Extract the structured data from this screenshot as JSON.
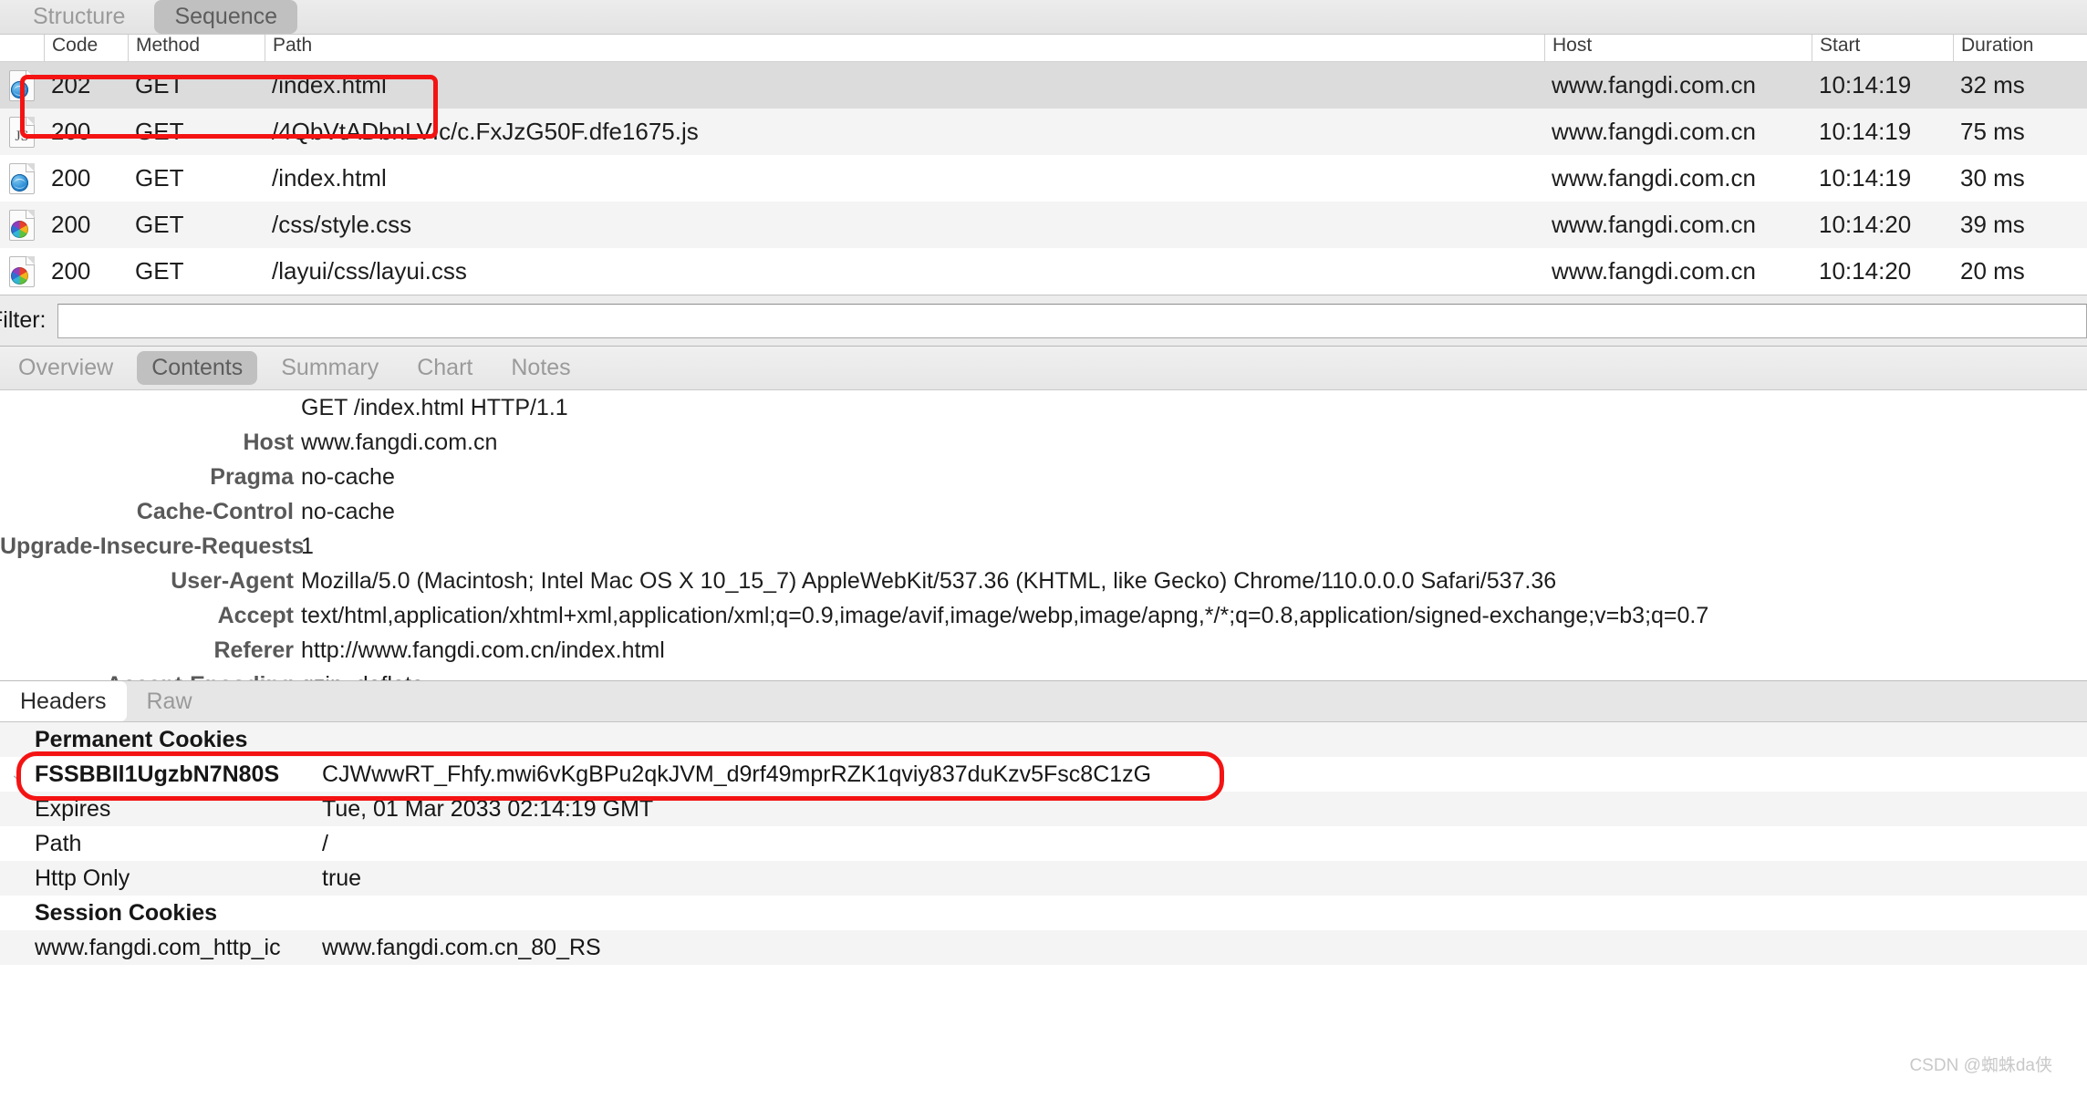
{
  "top_tabs": [
    {
      "label": "Structure",
      "active": false
    },
    {
      "label": "Sequence",
      "active": true
    }
  ],
  "request_table": {
    "columns": [
      "",
      "Code",
      "Method",
      "Path",
      "Host",
      "Start",
      "Duration"
    ],
    "rows": [
      {
        "icon": "html-document-icon",
        "code": "202",
        "method": "GET",
        "path": "/index.html",
        "host": "www.fangdi.com.cn",
        "start": "10:14:19",
        "duration": "32 ms",
        "selected": true
      },
      {
        "icon": "js-document-icon",
        "code": "200",
        "method": "GET",
        "path": "/4QbVtADbnLVIc/c.FxJzG50F.dfe1675.js",
        "host": "www.fangdi.com.cn",
        "start": "10:14:19",
        "duration": "75 ms",
        "selected": false
      },
      {
        "icon": "html-document-icon",
        "code": "200",
        "method": "GET",
        "path": "/index.html",
        "host": "www.fangdi.com.cn",
        "start": "10:14:19",
        "duration": "30 ms",
        "selected": false
      },
      {
        "icon": "css-document-icon",
        "code": "200",
        "method": "GET",
        "path": "/css/style.css",
        "host": "www.fangdi.com.cn",
        "start": "10:14:20",
        "duration": "39 ms",
        "selected": false
      },
      {
        "icon": "css-document-icon",
        "code": "200",
        "method": "GET",
        "path": "/layui/css/layui.css",
        "host": "www.fangdi.com.cn",
        "start": "10:14:20",
        "duration": "20 ms",
        "selected": false
      }
    ]
  },
  "filter": {
    "label": "Filter:",
    "value": "",
    "placeholder": ""
  },
  "detail_tabs": [
    {
      "label": "Overview",
      "active": false
    },
    {
      "label": "Contents",
      "active": true
    },
    {
      "label": "Summary",
      "active": false
    },
    {
      "label": "Chart",
      "active": false
    },
    {
      "label": "Notes",
      "active": false
    }
  ],
  "headers": [
    {
      "name": "",
      "value": "GET /index.html HTTP/1.1"
    },
    {
      "name": "Host",
      "value": "www.fangdi.com.cn"
    },
    {
      "name": "Pragma",
      "value": "no-cache"
    },
    {
      "name": "Cache-Control",
      "value": "no-cache"
    },
    {
      "name": "Upgrade-Insecure-Requests",
      "value": "1"
    },
    {
      "name": "User-Agent",
      "value": "Mozilla/5.0 (Macintosh; Intel Mac OS X 10_15_7) AppleWebKit/537.36 (KHTML, like Gecko) Chrome/110.0.0.0 Safari/537.36"
    },
    {
      "name": "Accept",
      "value": "text/html,application/xhtml+xml,application/xml;q=0.9,image/avif,image/webp,image/apng,*/*;q=0.8,application/signed-exchange;v=b3;q=0.7"
    },
    {
      "name": "Referer",
      "value": "http://www.fangdi.com.cn/index.html"
    },
    {
      "name": "Accept-Encoding",
      "value": "gzip, deflate"
    }
  ],
  "sub_tabs": [
    {
      "label": "Headers",
      "active": true
    },
    {
      "label": "Raw",
      "active": false
    }
  ],
  "cookies": [
    {
      "kind": "group",
      "name": "Permanent Cookies",
      "value": ""
    },
    {
      "kind": "cookie",
      "disclosure": "chevron-down-icon",
      "name": "FSSBBIl1UgzbN7N80S",
      "value": "CJWwwRT_Fhfy.mwi6vKgBPu2qkJVM_d9rf49mprRZK1qviy837duKzv5Fsc8C1zG"
    },
    {
      "kind": "attr",
      "name": "Expires",
      "value": "Tue, 01 Mar 2033 02:14:19 GMT"
    },
    {
      "kind": "attr",
      "name": "Path",
      "value": "/"
    },
    {
      "kind": "attr",
      "name": "Http Only",
      "value": "true"
    },
    {
      "kind": "group",
      "name": "Session Cookies",
      "value": ""
    },
    {
      "kind": "cookie2",
      "name": "www.fangdi.com_http_ic",
      "value": "www.fangdi.com.cn_80_RS"
    }
  ],
  "annotations": {
    "color": "#f41313",
    "highlight_row_index": 0,
    "highlight_cookie_index": 1
  },
  "watermark": "CSDN @蜘蛛da侠"
}
